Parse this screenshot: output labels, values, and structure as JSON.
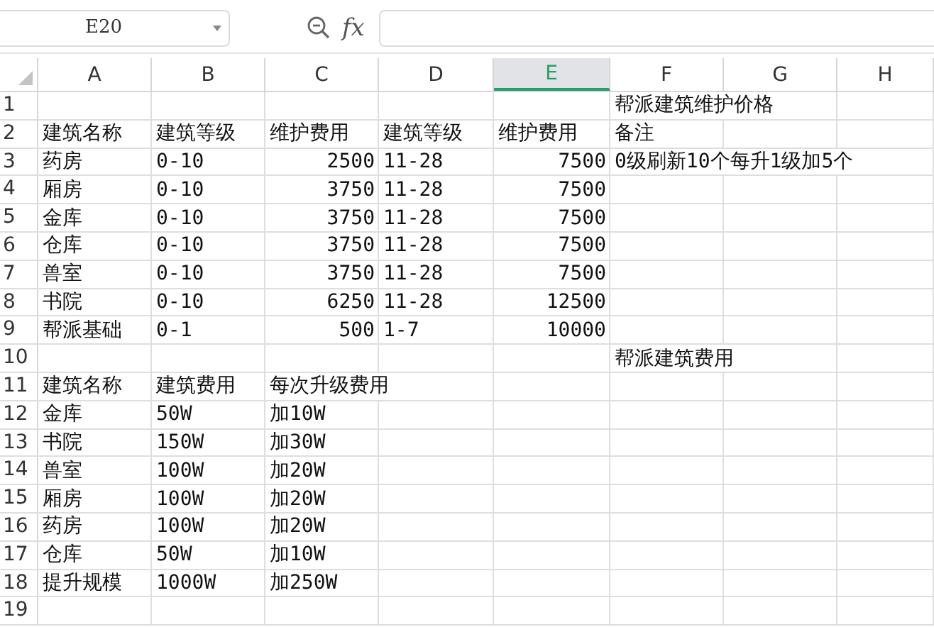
{
  "name_box": {
    "value": "E20"
  },
  "formula_bar": {
    "function_label": "fx"
  },
  "columns": [
    {
      "label": "A",
      "selected": false
    },
    {
      "label": "B",
      "selected": false
    },
    {
      "label": "C",
      "selected": false
    },
    {
      "label": "D",
      "selected": false
    },
    {
      "label": "E",
      "selected": true
    },
    {
      "label": "F",
      "selected": false
    },
    {
      "label": "G",
      "selected": false
    },
    {
      "label": "H",
      "selected": false
    }
  ],
  "rows": [
    {
      "number": "1",
      "cells": {
        "F": {
          "kind": "text",
          "text": "帮派建筑维护价格"
        }
      }
    },
    {
      "number": "2",
      "cells": {
        "A": {
          "kind": "text",
          "text": "建筑名称"
        },
        "B": {
          "kind": "text",
          "text": "建筑等级"
        },
        "C": {
          "kind": "text",
          "text": "维护费用"
        },
        "D": {
          "kind": "text",
          "text": "建筑等级"
        },
        "E": {
          "kind": "text",
          "text": "维护费用"
        },
        "F": {
          "kind": "text",
          "text": "备注"
        }
      }
    },
    {
      "number": "3",
      "cells": {
        "A": {
          "kind": "text",
          "text": "药房"
        },
        "B": {
          "kind": "text",
          "text": "0-10"
        },
        "C": {
          "kind": "number",
          "text": "2500"
        },
        "D": {
          "kind": "text",
          "text": "11-28"
        },
        "E": {
          "kind": "number",
          "text": "7500"
        },
        "F": {
          "kind": "text",
          "text": "0级刷新10个每升1级加5个"
        }
      }
    },
    {
      "number": "4",
      "cells": {
        "A": {
          "kind": "text",
          "text": "厢房"
        },
        "B": {
          "kind": "text",
          "text": "0-10"
        },
        "C": {
          "kind": "number",
          "text": "3750"
        },
        "D": {
          "kind": "text",
          "text": "11-28"
        },
        "E": {
          "kind": "number",
          "text": "7500"
        }
      }
    },
    {
      "number": "5",
      "cells": {
        "A": {
          "kind": "text",
          "text": "金库"
        },
        "B": {
          "kind": "text",
          "text": "0-10"
        },
        "C": {
          "kind": "number",
          "text": "3750"
        },
        "D": {
          "kind": "text",
          "text": "11-28"
        },
        "E": {
          "kind": "number",
          "text": "7500"
        }
      }
    },
    {
      "number": "6",
      "cells": {
        "A": {
          "kind": "text",
          "text": "仓库"
        },
        "B": {
          "kind": "text",
          "text": "0-10"
        },
        "C": {
          "kind": "number",
          "text": "3750"
        },
        "D": {
          "kind": "text",
          "text": "11-28"
        },
        "E": {
          "kind": "number",
          "text": "7500"
        }
      }
    },
    {
      "number": "7",
      "cells": {
        "A": {
          "kind": "text",
          "text": "兽室"
        },
        "B": {
          "kind": "text",
          "text": "0-10"
        },
        "C": {
          "kind": "number",
          "text": "3750"
        },
        "D": {
          "kind": "text",
          "text": "11-28"
        },
        "E": {
          "kind": "number",
          "text": "7500"
        }
      }
    },
    {
      "number": "8",
      "cells": {
        "A": {
          "kind": "text",
          "text": "书院"
        },
        "B": {
          "kind": "text",
          "text": "0-10"
        },
        "C": {
          "kind": "number",
          "text": "6250"
        },
        "D": {
          "kind": "text",
          "text": "11-28"
        },
        "E": {
          "kind": "number",
          "text": "12500"
        }
      }
    },
    {
      "number": "9",
      "cells": {
        "A": {
          "kind": "text",
          "text": "帮派基础"
        },
        "B": {
          "kind": "text",
          "text": "0-1"
        },
        "C": {
          "kind": "number",
          "text": "500"
        },
        "D": {
          "kind": "text",
          "text": "1-7"
        },
        "E": {
          "kind": "number",
          "text": "10000"
        }
      }
    },
    {
      "number": "10",
      "cells": {
        "F": {
          "kind": "text",
          "text": "帮派建筑费用"
        }
      }
    },
    {
      "number": "11",
      "cells": {
        "A": {
          "kind": "text",
          "text": "建筑名称"
        },
        "B": {
          "kind": "text",
          "text": "建筑费用"
        },
        "C": {
          "kind": "text",
          "text": "每次升级费用"
        }
      }
    },
    {
      "number": "12",
      "cells": {
        "A": {
          "kind": "text",
          "text": "金库"
        },
        "B": {
          "kind": "text",
          "text": "50W"
        },
        "C": {
          "kind": "text",
          "text": "加10W"
        }
      }
    },
    {
      "number": "13",
      "cells": {
        "A": {
          "kind": "text",
          "text": "书院"
        },
        "B": {
          "kind": "text",
          "text": "150W"
        },
        "C": {
          "kind": "text",
          "text": "加30W"
        }
      }
    },
    {
      "number": "14",
      "cells": {
        "A": {
          "kind": "text",
          "text": "兽室"
        },
        "B": {
          "kind": "text",
          "text": "100W"
        },
        "C": {
          "kind": "text",
          "text": "加20W"
        }
      }
    },
    {
      "number": "15",
      "cells": {
        "A": {
          "kind": "text",
          "text": "厢房"
        },
        "B": {
          "kind": "text",
          "text": "100W"
        },
        "C": {
          "kind": "text",
          "text": "加20W"
        }
      }
    },
    {
      "number": "16",
      "cells": {
        "A": {
          "kind": "text",
          "text": "药房"
        },
        "B": {
          "kind": "text",
          "text": "100W"
        },
        "C": {
          "kind": "text",
          "text": "加20W"
        }
      }
    },
    {
      "number": "17",
      "cells": {
        "A": {
          "kind": "text",
          "text": "仓库"
        },
        "B": {
          "kind": "text",
          "text": "50W"
        },
        "C": {
          "kind": "text",
          "text": "加10W"
        }
      }
    },
    {
      "number": "18",
      "cells": {
        "A": {
          "kind": "text",
          "text": "提升规模"
        },
        "B": {
          "kind": "text",
          "text": "1000W"
        },
        "C": {
          "kind": "text",
          "text": "加250W"
        }
      }
    },
    {
      "number": "19"
    }
  ]
}
